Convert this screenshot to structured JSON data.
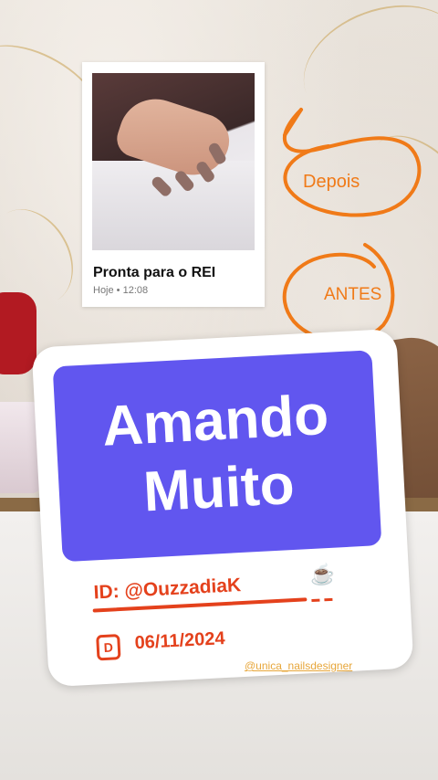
{
  "polaroid": {
    "title": "Pronta para o REI",
    "meta": "Hoje • 12:08"
  },
  "annotations": {
    "after": "Depois",
    "before": "ANTES",
    "accent_color": "#f07a18"
  },
  "sticker": {
    "headline_line1": "Amando",
    "headline_line2": "Muito",
    "badge_color": "#6156ef",
    "id_label": "ID: @OuzzadiaK",
    "cup_icon": "☕",
    "date_icon_letter": "D",
    "date": "06/11/2024",
    "text_color": "#e4411c"
  },
  "handle_text": "@unica_nailsdesigner"
}
